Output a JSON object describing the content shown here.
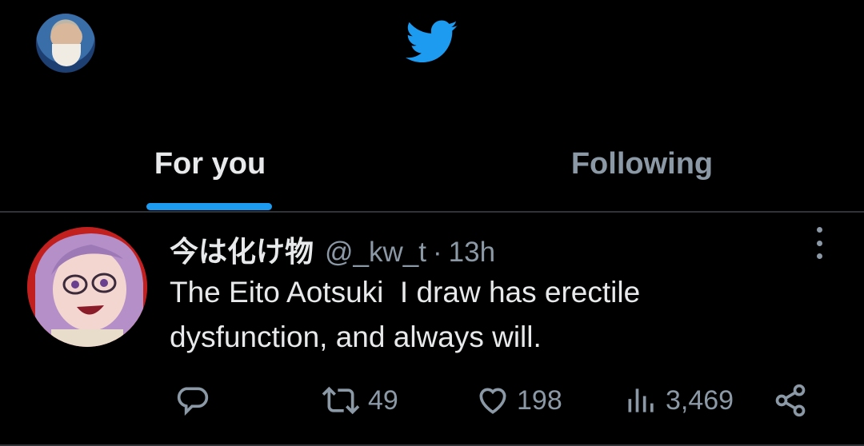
{
  "topbar": {
    "avatar_icon": "profile-avatar",
    "logo_icon": "twitter-bird-icon",
    "brand_color": "#1d9bf0"
  },
  "tabs": [
    {
      "label": "For you",
      "active": true
    },
    {
      "label": "Following",
      "active": false
    }
  ],
  "tweet": {
    "display_name": "今は化け物",
    "handle": "@_kw_t",
    "separator": "·",
    "time": "13h",
    "text": "The Eito Aotsuki  I draw has erectile dysfunction, and always will.",
    "actions": {
      "reply": {
        "icon": "reply-icon",
        "count": ""
      },
      "retweet": {
        "icon": "retweet-icon",
        "count": "49"
      },
      "like": {
        "icon": "heart-icon",
        "count": "198"
      },
      "views": {
        "icon": "views-icon",
        "count": "3,469"
      },
      "share": {
        "icon": "share-icon"
      }
    }
  },
  "colors": {
    "background": "#000000",
    "text": "#e7e9ea",
    "muted": "#8b98a5",
    "accent": "#1d9bf0",
    "divider": "#2f3336"
  }
}
